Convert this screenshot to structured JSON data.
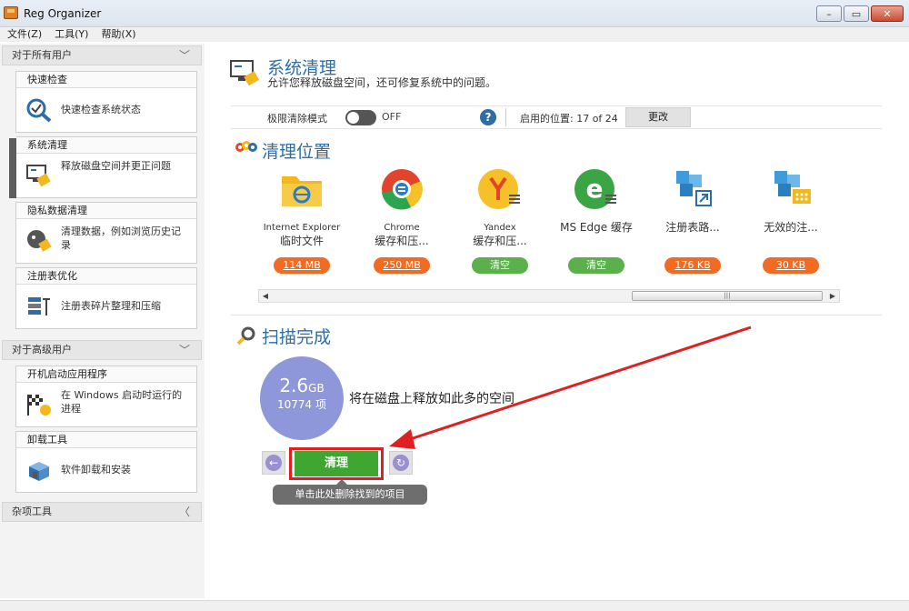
{
  "window": {
    "title": "Reg Organizer",
    "minimize": "▭",
    "maximize": "▭",
    "close": "✕"
  },
  "menu": [
    "文件(Z)",
    "工具(Y)",
    "帮助(X)"
  ],
  "sidebar": {
    "group1": {
      "label": "对于所有用户",
      "chevron": "﹀"
    },
    "group2": {
      "label": "对于高级用户",
      "chevron": "﹀"
    },
    "group3": {
      "label": "杂项工具",
      "chevron": "〈"
    },
    "cards": [
      {
        "title": "快速检查",
        "text": "快速检查系统状态",
        "icon": "magnifier-check-icon"
      },
      {
        "title": "系统清理",
        "text": "释放磁盘空间并更正问题",
        "icon": "pc-broom-icon",
        "active": true
      },
      {
        "title": "隐私数据清理",
        "text": "清理数据，例如浏览历史记录",
        "icon": "privacy-icon"
      },
      {
        "title": "注册表优化",
        "text": "注册表碎片整理和压缩",
        "icon": "registry-icon"
      },
      {
        "title": "开机启动应用程序",
        "text": "在 Windows 启动时运行的进程",
        "icon": "startup-flag-icon"
      },
      {
        "title": "卸载工具",
        "text": "软件卸载和安装",
        "icon": "uninstall-box-icon"
      }
    ]
  },
  "main": {
    "title": "系统清理",
    "subtitle": "允许您释放磁盘空间，还可修复系统中的问题。",
    "options": {
      "mode_label": "极限清除模式",
      "mode_state": "OFF",
      "help": "?",
      "enabled": "启用的位置: 17 of 24",
      "change_button": "更改"
    },
    "locations_title": "清理位置",
    "locations": [
      {
        "line1": "Internet Explorer",
        "line2": "临时文件",
        "action": "114 MB",
        "kind": "size",
        "icon": "ie-folder-icon"
      },
      {
        "line1": "Chrome",
        "line2": "缓存和压...",
        "action": "250 MB",
        "kind": "size",
        "icon": "chrome-icon"
      },
      {
        "line1": "Yandex",
        "line2": "缓存和压...",
        "action": "清空",
        "kind": "empty",
        "icon": "yandex-icon"
      },
      {
        "line1": "MS Edge 缓存",
        "line2": "",
        "action": "清空",
        "kind": "empty",
        "icon": "edge-icon"
      },
      {
        "line1": "注册表路...",
        "line2": "",
        "action": "176 KB",
        "kind": "size",
        "icon": "registry-cubes-icon"
      },
      {
        "line1": "无效的注...",
        "line2": "",
        "action": "30 KB",
        "kind": "size",
        "icon": "invalid-cubes-icon"
      }
    ],
    "scroll": {
      "left": "◀",
      "right": "▶",
      "grip": "|||"
    },
    "scan_title": "扫描完成",
    "result": {
      "size_value": "2.6",
      "size_unit": "GB",
      "count": "10774 项",
      "description": "将在磁盘上释放如此多的空间"
    },
    "clean_button": "清理",
    "tooltip": "单击此处删除找到的项目",
    "back": "←",
    "refresh": "↻"
  },
  "colors": {
    "accent": "#2b6ea9",
    "orange": "#f26b22",
    "green": "#3fa632",
    "bubble": "#8d97d9",
    "annotation": "#e02020"
  }
}
